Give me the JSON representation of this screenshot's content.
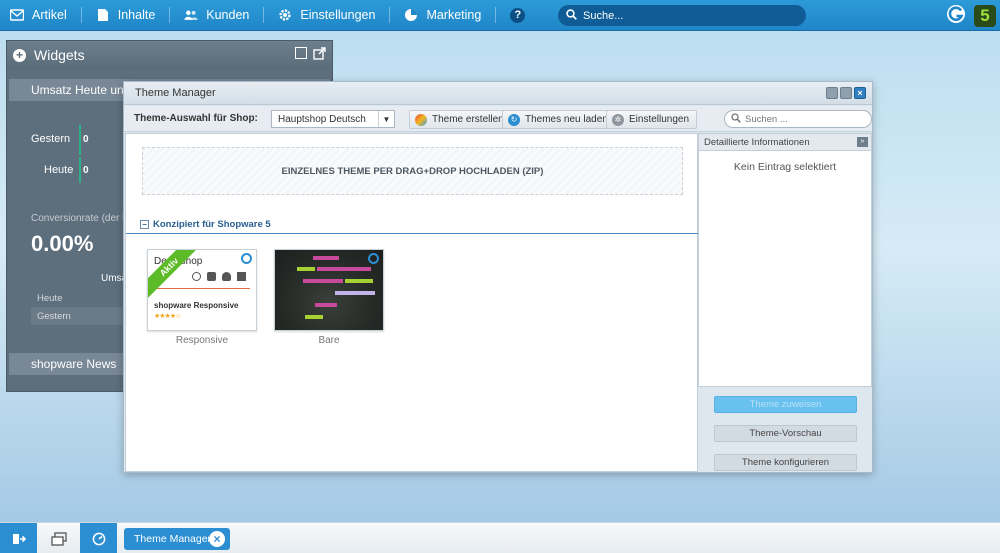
{
  "nav": {
    "items": [
      {
        "label": "Artikel",
        "icon": "article-icon"
      },
      {
        "label": "Inhalte",
        "icon": "content-icon"
      },
      {
        "label": "Kunden",
        "icon": "customers-icon"
      },
      {
        "label": "Einstellungen",
        "icon": "settings-gear-icon"
      },
      {
        "label": "Marketing",
        "icon": "marketing-pie-icon"
      }
    ],
    "help_label": "?",
    "search_placeholder": "Suche..."
  },
  "brand": {
    "logo_letter": "5"
  },
  "widgets": {
    "title": "Widgets",
    "umsatz_title": "Umsatz Heute und",
    "gestern_label": "Gestern",
    "gestern_value": "0",
    "heute_label": "Heute",
    "heute_value": "0",
    "conversion_label": "Conversionrate (der le",
    "conversion_value": "0.00%",
    "umsatz_small": "Umsa",
    "row_heute": "Heute",
    "row_gestern": "Gestern",
    "news_title": "shopware News"
  },
  "theme_manager": {
    "title": "Theme Manager",
    "shop_select_label": "Theme-Auswahl für Shop:",
    "shop_select_value": "Hauptshop Deutsch",
    "toolbar": {
      "create_label": "Theme erstellen",
      "reload_label": "Themes neu laden",
      "settings_label": "Einstellungen",
      "search_placeholder": "Suchen ..."
    },
    "dropzone_text": "EINZELNES THEME PER DRAG+DROP HOCHLADEN (ZIP)",
    "group_title": "Konzipiert für Shopware 5",
    "themes": [
      {
        "name": "Responsive",
        "badge": "Aktiv",
        "thumb_title": "shopware Responsive",
        "thumb_shop": "Demoshop"
      },
      {
        "name": "Bare"
      }
    ],
    "side": {
      "header": "Detaillierte Informationen",
      "empty_text": "Kein Eintrag selektiert",
      "btn_assign": "Theme zuweisen",
      "btn_preview": "Theme-Vorschau",
      "btn_configure": "Theme konfigurieren"
    }
  },
  "taskbar": {
    "active_task": "Theme Manager"
  },
  "colors": {
    "topbar": "#2d9bd8",
    "accent": "#2c8ed2",
    "widget_bg": "#5d6e7c",
    "active_green": "#5dbb28"
  }
}
